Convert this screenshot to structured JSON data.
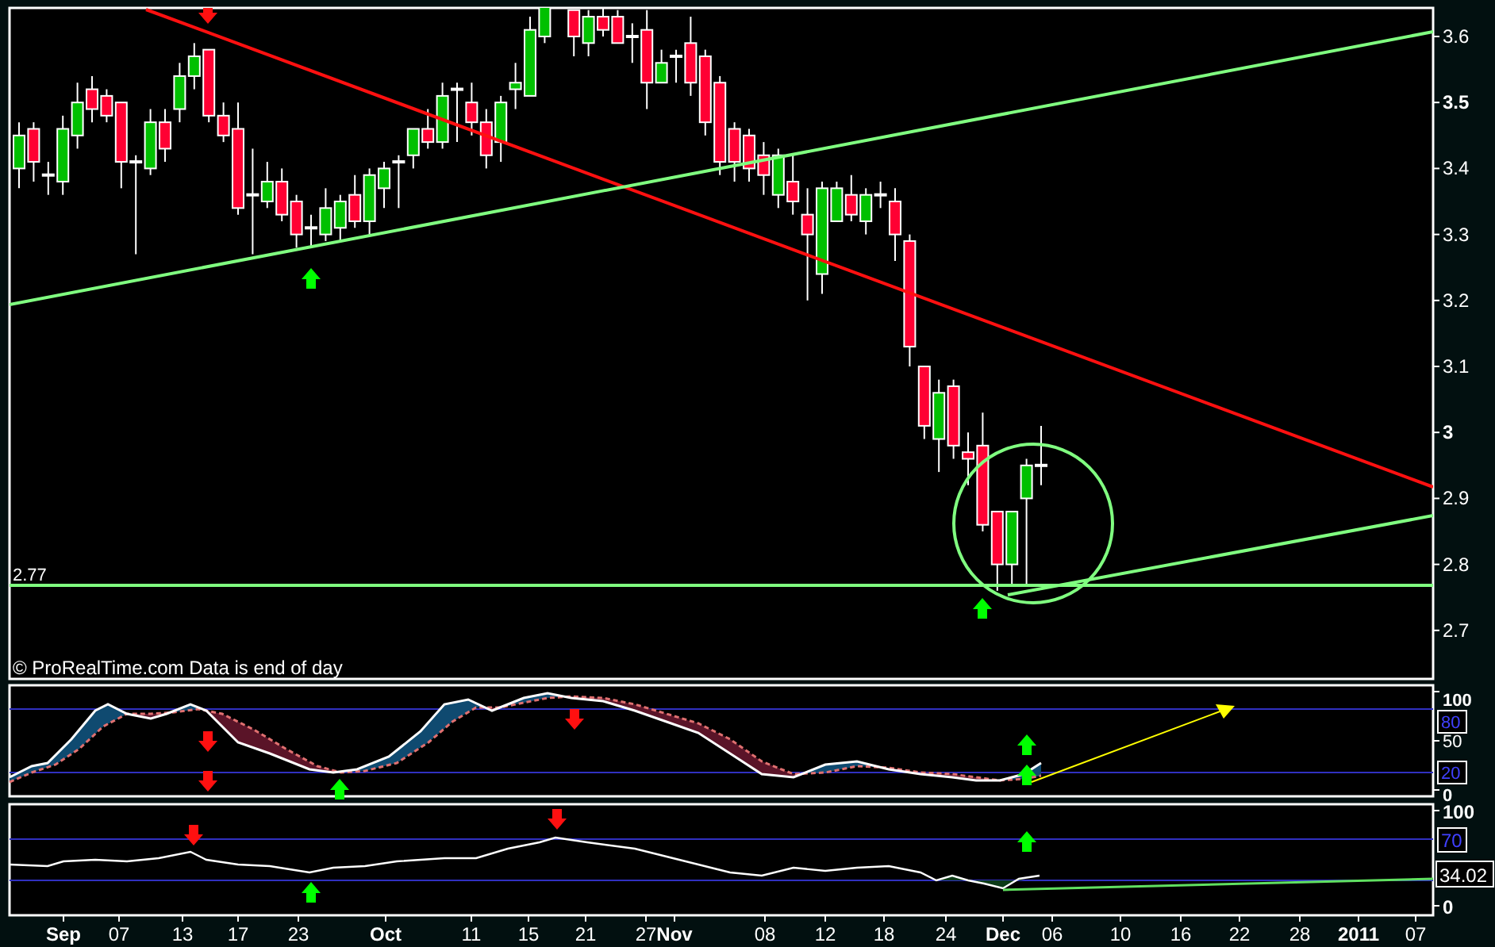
{
  "main_chart": {
    "y_axis_labels": [
      {
        "text": "3.6",
        "major": false
      },
      {
        "text": "3.5",
        "major": true
      },
      {
        "text": "3.4",
        "major": false
      },
      {
        "text": "3.3",
        "major": false
      },
      {
        "text": "3.2",
        "major": false
      },
      {
        "text": "3.1",
        "major": false
      },
      {
        "text": "3",
        "major": true
      },
      {
        "text": "2.9",
        "major": false
      },
      {
        "text": "2.8",
        "major": false
      },
      {
        "text": "2.7",
        "major": false
      }
    ],
    "level_label": "2.77",
    "source_note": "© ProRealTime.com  Data is end of day"
  },
  "oscillator_panel": {
    "axis_labels": [
      "100",
      "50",
      "0"
    ],
    "level_badges": [
      "80",
      "20"
    ]
  },
  "rsi_panel": {
    "axis_labels": [
      "100",
      "0"
    ],
    "level_badges": [
      "70"
    ],
    "value_badge": "34.02"
  },
  "x_axis": {
    "labels": [
      {
        "text": "Sep",
        "major": true
      },
      {
        "text": "07",
        "major": false
      },
      {
        "text": "13",
        "major": false
      },
      {
        "text": "17",
        "major": false
      },
      {
        "text": "23",
        "major": false
      },
      {
        "text": "Oct",
        "major": true
      },
      {
        "text": "11",
        "major": false
      },
      {
        "text": "15",
        "major": false
      },
      {
        "text": "21",
        "major": false
      },
      {
        "text": "27",
        "major": false
      },
      {
        "text": "Nov",
        "major": true
      },
      {
        "text": "08",
        "major": false
      },
      {
        "text": "12",
        "major": false
      },
      {
        "text": "18",
        "major": false
      },
      {
        "text": "24",
        "major": false
      },
      {
        "text": "Dec",
        "major": true
      },
      {
        "text": "06",
        "major": false
      },
      {
        "text": "10",
        "major": false
      },
      {
        "text": "16",
        "major": false
      },
      {
        "text": "22",
        "major": false
      },
      {
        "text": "28",
        "major": false
      },
      {
        "text": "2011",
        "major": true
      },
      {
        "text": "07",
        "major": false
      }
    ]
  }
}
